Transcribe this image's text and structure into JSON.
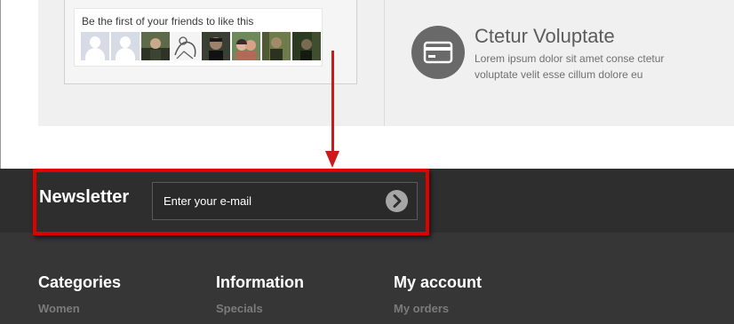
{
  "facebook_widget": {
    "prompt": "Be the first of your friends to like this",
    "faces": [
      {
        "name": "face-1",
        "type": "blank"
      },
      {
        "name": "face-2",
        "type": "blank"
      },
      {
        "name": "face-3",
        "type": "photo",
        "colors": [
          "#5e6a4a",
          "#2e3325"
        ]
      },
      {
        "name": "face-4",
        "type": "sketch",
        "colors": [
          "#f4f4f4",
          "#555555"
        ]
      },
      {
        "name": "face-5",
        "type": "photo",
        "colors": [
          "#3a3f33",
          "#111111"
        ]
      },
      {
        "name": "face-6",
        "type": "photo",
        "colors": [
          "#b06a55",
          "#3b2b2b"
        ]
      },
      {
        "name": "face-7",
        "type": "photo",
        "colors": [
          "#6e7b4a",
          "#2b3320"
        ]
      },
      {
        "name": "face-8",
        "type": "photo",
        "colors": [
          "#2d3a22",
          "#141a10"
        ]
      }
    ]
  },
  "feature": {
    "icon": "credit-card-icon",
    "title": "Ctetur Voluptate",
    "description": "Lorem ipsum dolor sit amet conse ctetur voluptate velit esse cillum dolore eu"
  },
  "newsletter": {
    "title": "Newsletter",
    "email_placeholder": "Enter your e-mail",
    "submit_icon": "chevron-right-circle-icon"
  },
  "footer": {
    "columns": [
      {
        "title": "Categories",
        "link": "Women"
      },
      {
        "title": "Information",
        "link": "Specials"
      },
      {
        "title": "My account",
        "link": "My orders"
      }
    ]
  },
  "colors": {
    "highlight": "#e00000",
    "arrow": "#cc1a1a",
    "newsletter_bg": "#2e2e2e",
    "footer_bg": "#363636"
  }
}
